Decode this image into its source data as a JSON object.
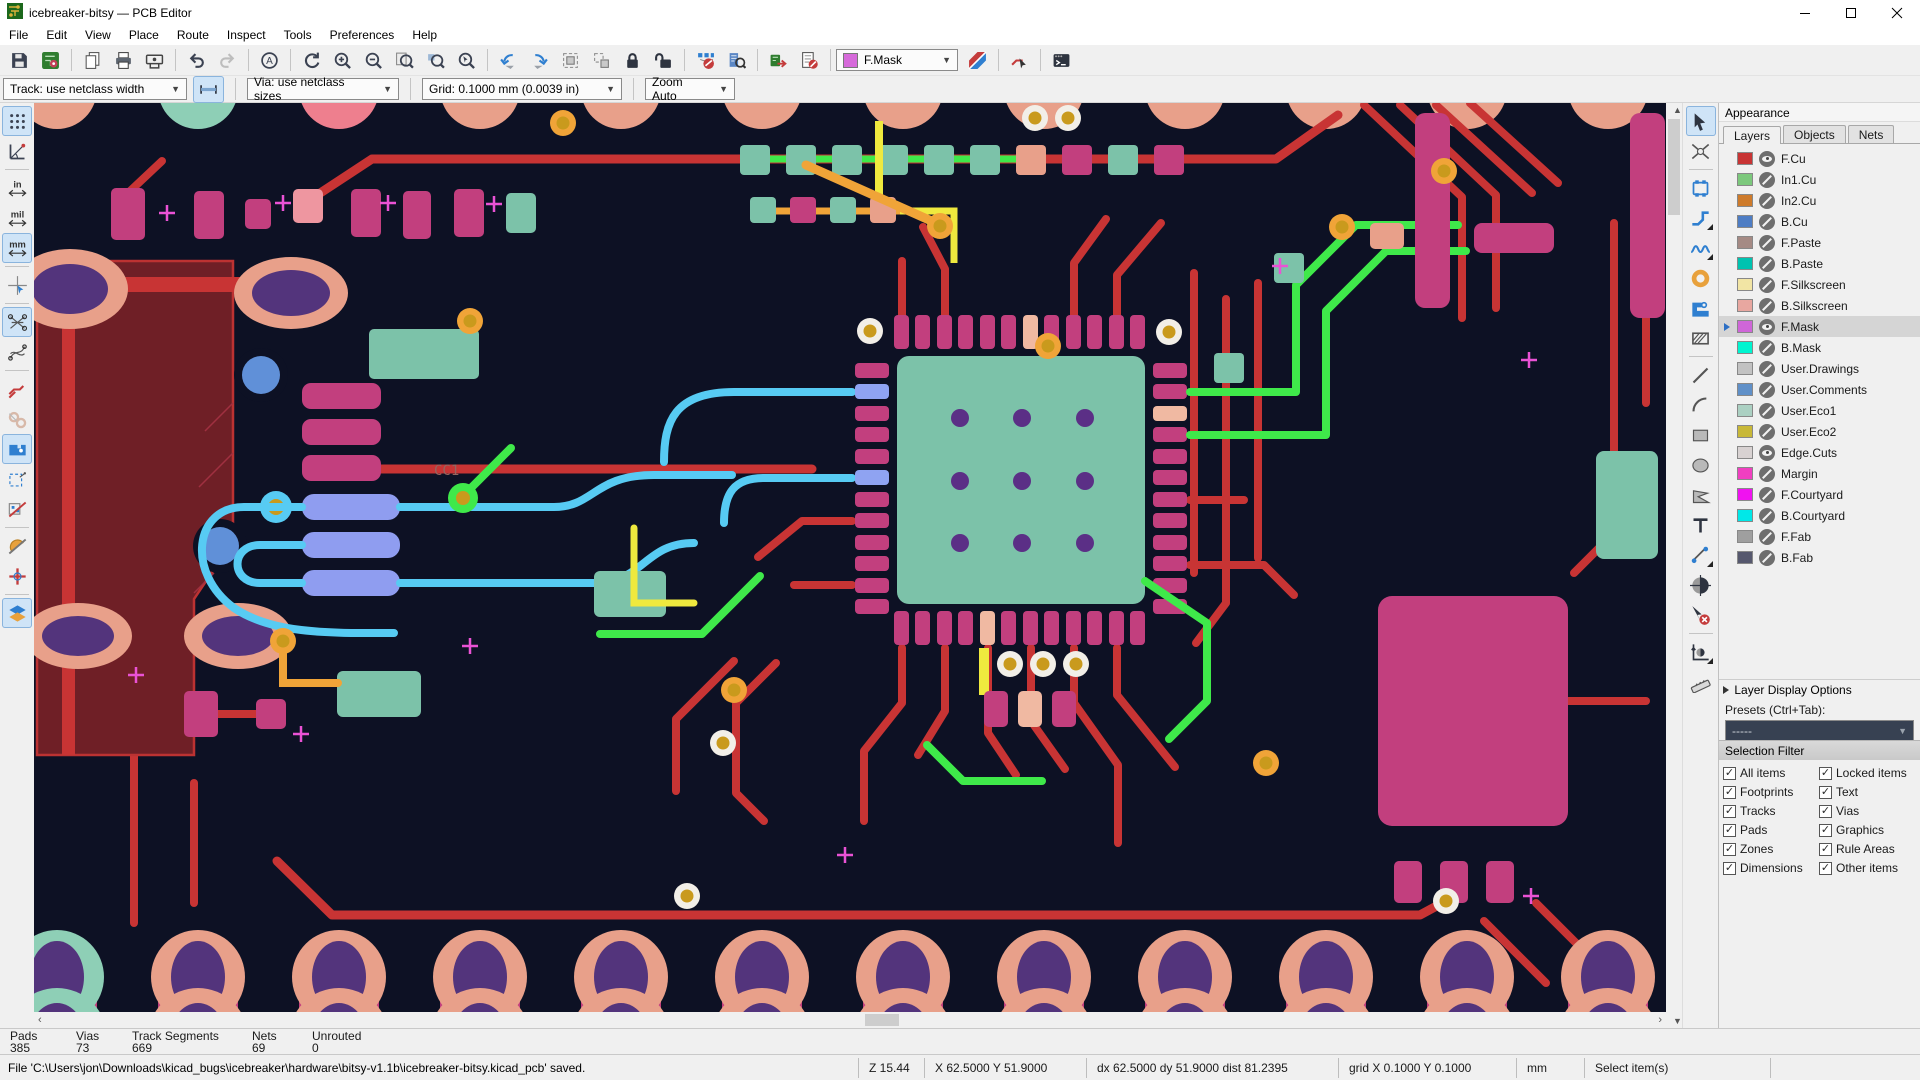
{
  "window": {
    "title": "icebreaker-bitsy — PCB Editor"
  },
  "menubar": {
    "items": [
      "File",
      "Edit",
      "View",
      "Place",
      "Route",
      "Inspect",
      "Tools",
      "Preferences",
      "Help"
    ]
  },
  "toolbar": {
    "layer_selector": {
      "value": "F.Mask",
      "color": "#d66ada"
    },
    "track_combo": "Track: use netclass width",
    "via_combo": "Via: use netclass sizes",
    "grid_combo": "Grid: 0.1000 mm (0.0039 in)",
    "zoom_combo": "Zoom Auto"
  },
  "appearance": {
    "title": "Appearance",
    "tabs": [
      "Layers",
      "Objects",
      "Nets"
    ],
    "layers": [
      {
        "name": "F.Cu",
        "color": "#c83434",
        "visible": true
      },
      {
        "name": "In1.Cu",
        "color": "#7cc87c",
        "visible": false
      },
      {
        "name": "In2.Cu",
        "color": "#ce7b2b",
        "visible": false
      },
      {
        "name": "B.Cu",
        "color": "#4e7dc4",
        "visible": false
      },
      {
        "name": "F.Paste",
        "color": "#a58a84",
        "visible": false
      },
      {
        "name": "B.Paste",
        "color": "#00c3b0",
        "visible": false
      },
      {
        "name": "F.Silkscreen",
        "color": "#f2e5a4",
        "visible": false
      },
      {
        "name": "B.Silkscreen",
        "color": "#e8a7a0",
        "visible": false
      },
      {
        "name": "F.Mask",
        "color": "#cf66d8",
        "visible": true
      },
      {
        "name": "B.Mask",
        "color": "#00f5d0",
        "visible": false
      },
      {
        "name": "User.Drawings",
        "color": "#c2c2c2",
        "visible": false
      },
      {
        "name": "User.Comments",
        "color": "#6090c8",
        "visible": false
      },
      {
        "name": "User.Eco1",
        "color": "#abd0c2",
        "visible": false
      },
      {
        "name": "User.Eco2",
        "color": "#c8b838",
        "visible": false
      },
      {
        "name": "Edge.Cuts",
        "color": "#d8d2d2",
        "visible": true
      },
      {
        "name": "Margin",
        "color": "#f03fc0",
        "visible": false
      },
      {
        "name": "F.Courtyard",
        "color": "#f012f0",
        "visible": false
      },
      {
        "name": "B.Courtyard",
        "color": "#00e8e8",
        "visible": false
      },
      {
        "name": "F.Fab",
        "color": "#9f9f9f",
        "visible": false
      },
      {
        "name": "B.Fab",
        "color": "#56586e",
        "visible": false
      }
    ],
    "layer_display_options": "Layer Display Options",
    "presets_label": "Presets (Ctrl+Tab):",
    "presets_value": "-----"
  },
  "selection_filter": {
    "title": "Selection Filter",
    "items": [
      {
        "label": "All items",
        "checked": true
      },
      {
        "label": "Locked items",
        "checked": true
      },
      {
        "label": "Footprints",
        "checked": true
      },
      {
        "label": "Text",
        "checked": true
      },
      {
        "label": "Tracks",
        "checked": true
      },
      {
        "label": "Vias",
        "checked": true
      },
      {
        "label": "Pads",
        "checked": true
      },
      {
        "label": "Graphics",
        "checked": true
      },
      {
        "label": "Zones",
        "checked": true
      },
      {
        "label": "Rule Areas",
        "checked": true
      },
      {
        "label": "Dimensions",
        "checked": true
      },
      {
        "label": "Other items",
        "checked": true
      }
    ]
  },
  "statusbar": {
    "counts": [
      {
        "label": "Pads",
        "value": "385"
      },
      {
        "label": "Vias",
        "value": "73"
      },
      {
        "label": "Track Segments",
        "value": "669"
      },
      {
        "label": "Nets",
        "value": "69"
      },
      {
        "label": "Unrouted",
        "value": "0"
      }
    ],
    "message": "File 'C:\\Users\\jon\\Downloads\\kicad_bugs\\icebreaker\\hardware\\bitsy-v1.1b\\icebreaker-bitsy.kicad_pcb' saved.",
    "zoom": "Z 15.44",
    "cursor": "X 62.5000  Y 51.9000",
    "delta": "dx 62.5000  dy 51.9000  dist 81.2395",
    "grid": "grid X 0.1000  Y 0.1000",
    "units": "mm",
    "hint": "Select item(s)"
  },
  "canvas": {
    "cc1_label": "CC1",
    "palette": {
      "bg": "#0d1124",
      "cu": "#c83434",
      "zone": "#6f1f26",
      "zoneline": "#bc3232",
      "mg": "#c23f7e",
      "sal": "#e8a08a",
      "pur": "#53347c",
      "dot": "#5b2f86",
      "teal": "#7cc2a9",
      "cyan": "#57cbf3",
      "grn": "#3fe94a",
      "yel": "#efe93e",
      "org": "#f0a438",
      "lav": "#8f9df0",
      "gold": "#c99a1d",
      "wvia": "#f2efe8",
      "blu": "#6090d8",
      "pink": "#ee7f8e",
      "crx": "#ea52d5",
      "lbltxt": "#96655f"
    }
  }
}
